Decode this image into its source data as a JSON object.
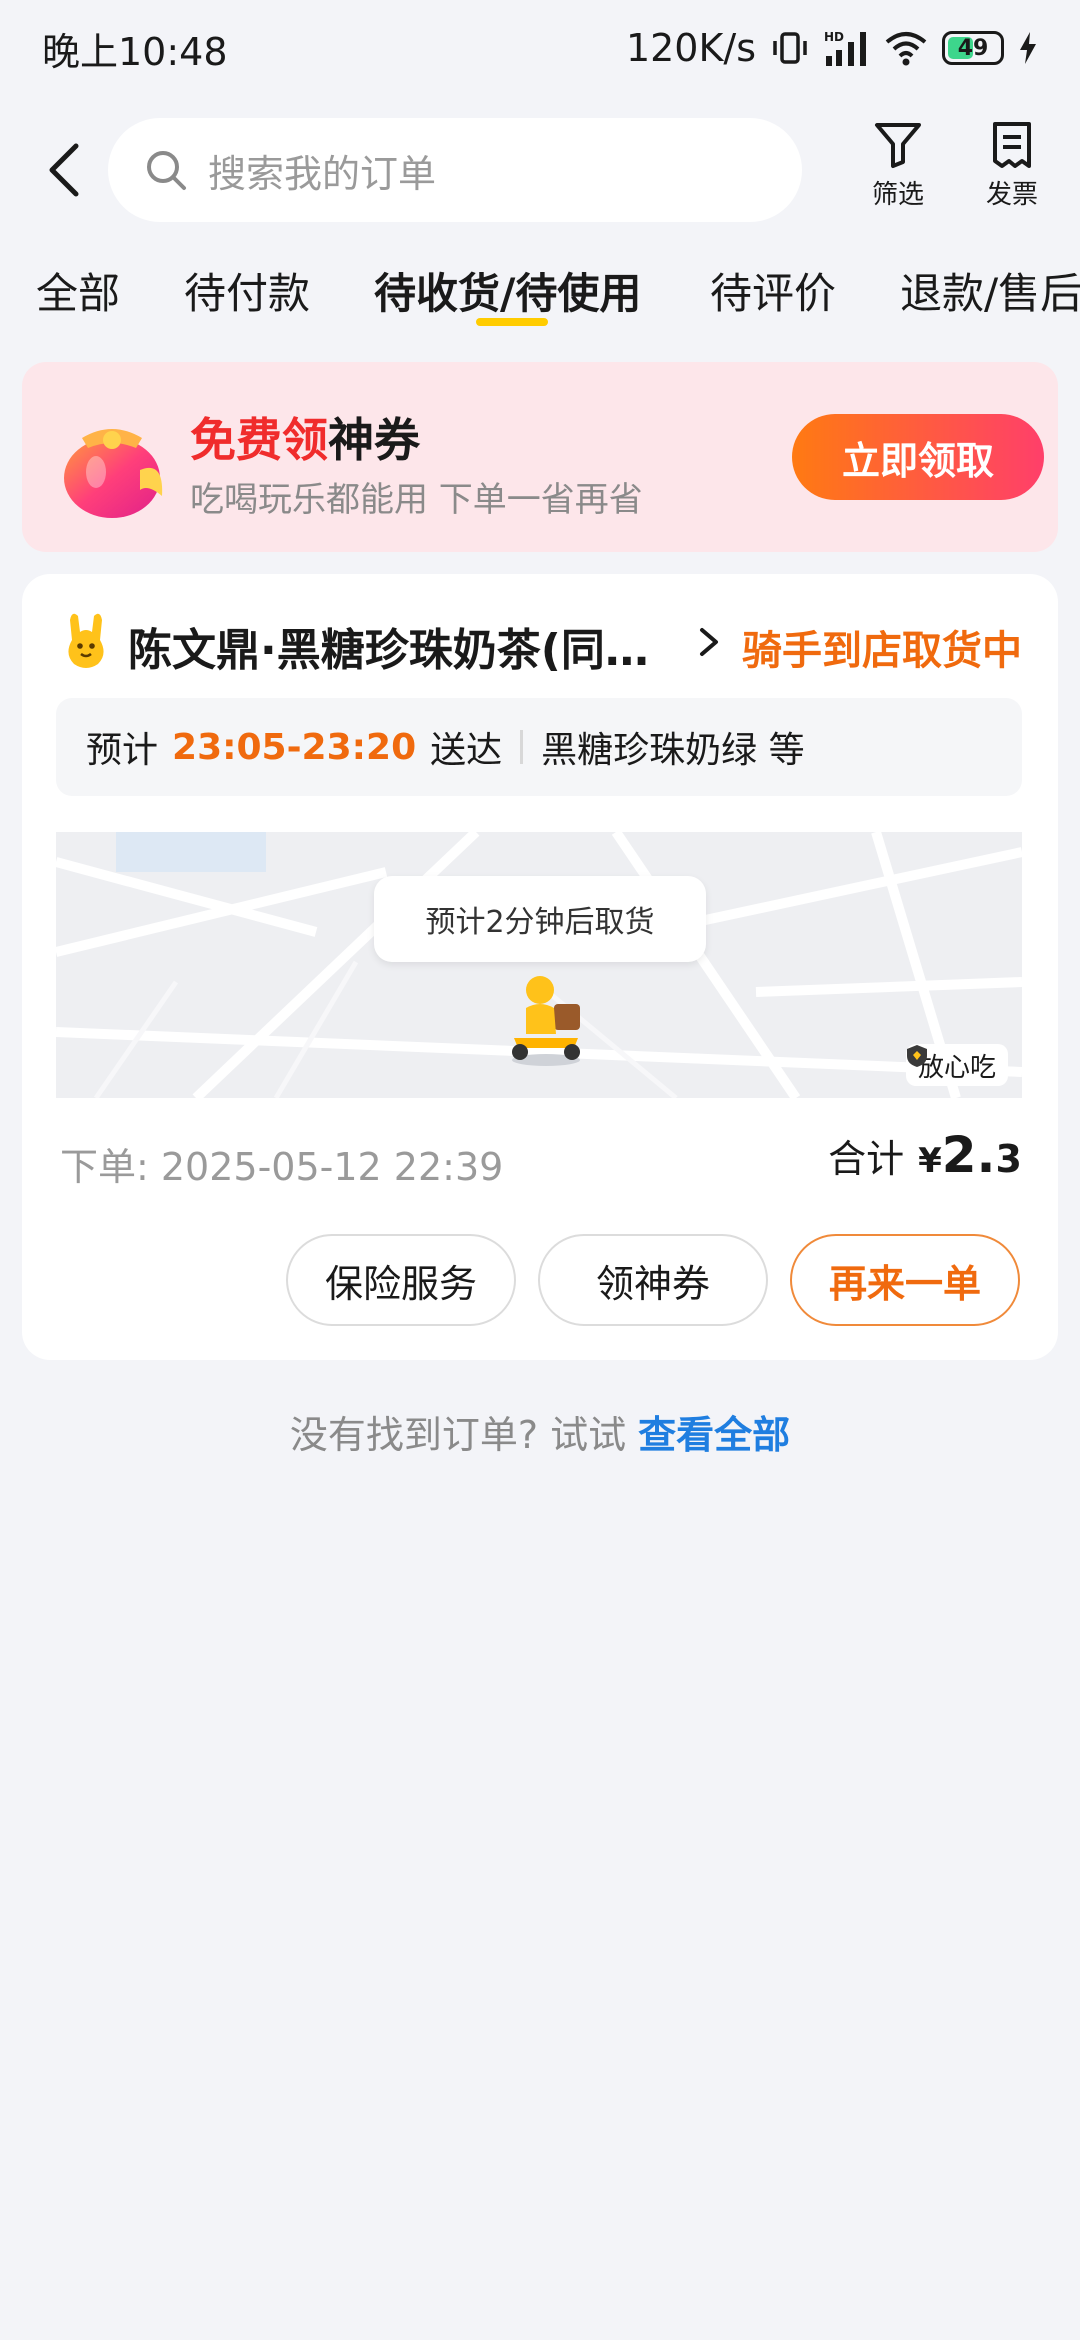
{
  "status_bar": {
    "time": "晚上10:48",
    "network_speed": "120K/s",
    "battery_level": "49",
    "battery_fraction": 0.49,
    "signal_label": "HD"
  },
  "header": {
    "search_placeholder": "搜索我的订单",
    "filter_label": "筛选",
    "invoice_label": "发票"
  },
  "tabs": [
    {
      "label": "全部",
      "active": false
    },
    {
      "label": "待付款",
      "active": false
    },
    {
      "label": "待收货/待使用",
      "active": true
    },
    {
      "label": "待评价",
      "active": false
    },
    {
      "label": "退款/售后",
      "active": false
    }
  ],
  "coupon_banner": {
    "title_highlight": "免费领",
    "title_rest": "神券",
    "subtitle": "吃喝玩乐都能用 下单一省再省",
    "button_label": "立即领取"
  },
  "order": {
    "shop_name": "陈文鼎·黑糖珍珠奶茶(同…",
    "status": "骑手到店取货中",
    "eta_prefix": "预计",
    "eta_time": "23:05-23:20",
    "eta_suffix": "送达",
    "items": "黑糖珍珠奶绿 等",
    "map_bubble": "预计2分钟后取货",
    "safe_badge": "放心吃",
    "order_time": "下单: 2025-05-12 22:39",
    "total_label": "合计",
    "total_currency": "¥",
    "total_int": "2.",
    "total_dec": "3",
    "actions": {
      "insurance": "保险服务",
      "coupon": "领神券",
      "reorder": "再来一单"
    }
  },
  "footer": {
    "hint": "没有找到订单? 试试",
    "link": "查看全部"
  },
  "colors": {
    "accent_orange": "#f06a0e",
    "tab_underline": "#ffcc00",
    "link_blue": "#1f7ee0",
    "coupon_red": "#f02c2c"
  }
}
